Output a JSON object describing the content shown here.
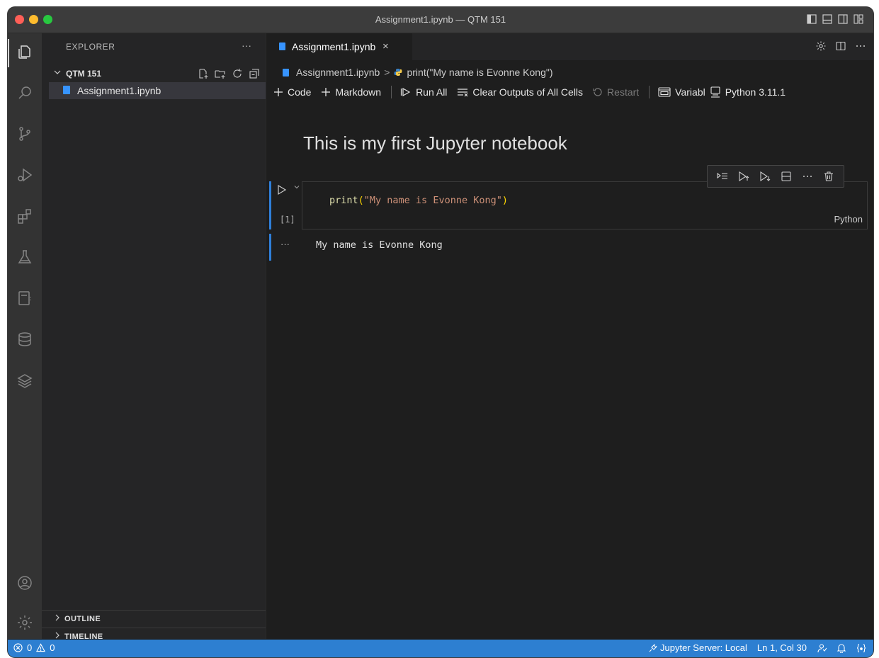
{
  "window": {
    "title": "Assignment1.ipynb — QTM 151"
  },
  "activity_bar": {
    "items": [
      "explorer-icon",
      "search-icon",
      "source-control-icon",
      "run-debug-icon",
      "extensions-icon",
      "testing-icon",
      "jupyter-icon",
      "database-icon",
      "layers-icon"
    ],
    "bottom": [
      "account-icon",
      "settings-gear-icon"
    ]
  },
  "sidebar": {
    "title": "EXPLORER",
    "more": "···",
    "folder": "QTM 151",
    "files": [
      {
        "name": "Assignment1.ipynb"
      }
    ],
    "sections": [
      "OUTLINE",
      "TIMELINE"
    ]
  },
  "editor": {
    "tab": {
      "label": "Assignment1.ipynb",
      "close": "×"
    },
    "breadcrumb": {
      "file": "Assignment1.ipynb",
      "separator": ">",
      "symbol": "print(\"My name is Evonne Kong\")"
    },
    "toolbar": {
      "code": "Code",
      "markdown": "Markdown",
      "run_all": "Run All",
      "clear_outputs": "Clear Outputs of All Cells",
      "restart": "Restart",
      "variables": "Variabl",
      "kernel": "Python 3.11.1"
    },
    "markdown_cell": {
      "heading": "This is my first Jupyter notebook"
    },
    "code_cell": {
      "code_fn": "print",
      "code_open": "(",
      "code_str": "\"My name is Evonne Kong\"",
      "code_close": ")",
      "exec_count": "[1]",
      "language": "Python"
    },
    "output": {
      "dots": "···",
      "text": "My name is Evonne Kong"
    }
  },
  "status_bar": {
    "errors": "0",
    "warnings": "0",
    "jupyter_server": "Jupyter Server: Local",
    "cursor": "Ln 1, Col 30"
  },
  "colors": {
    "accent": "#2d7fd1",
    "notebook_icon": "#3794ff"
  }
}
